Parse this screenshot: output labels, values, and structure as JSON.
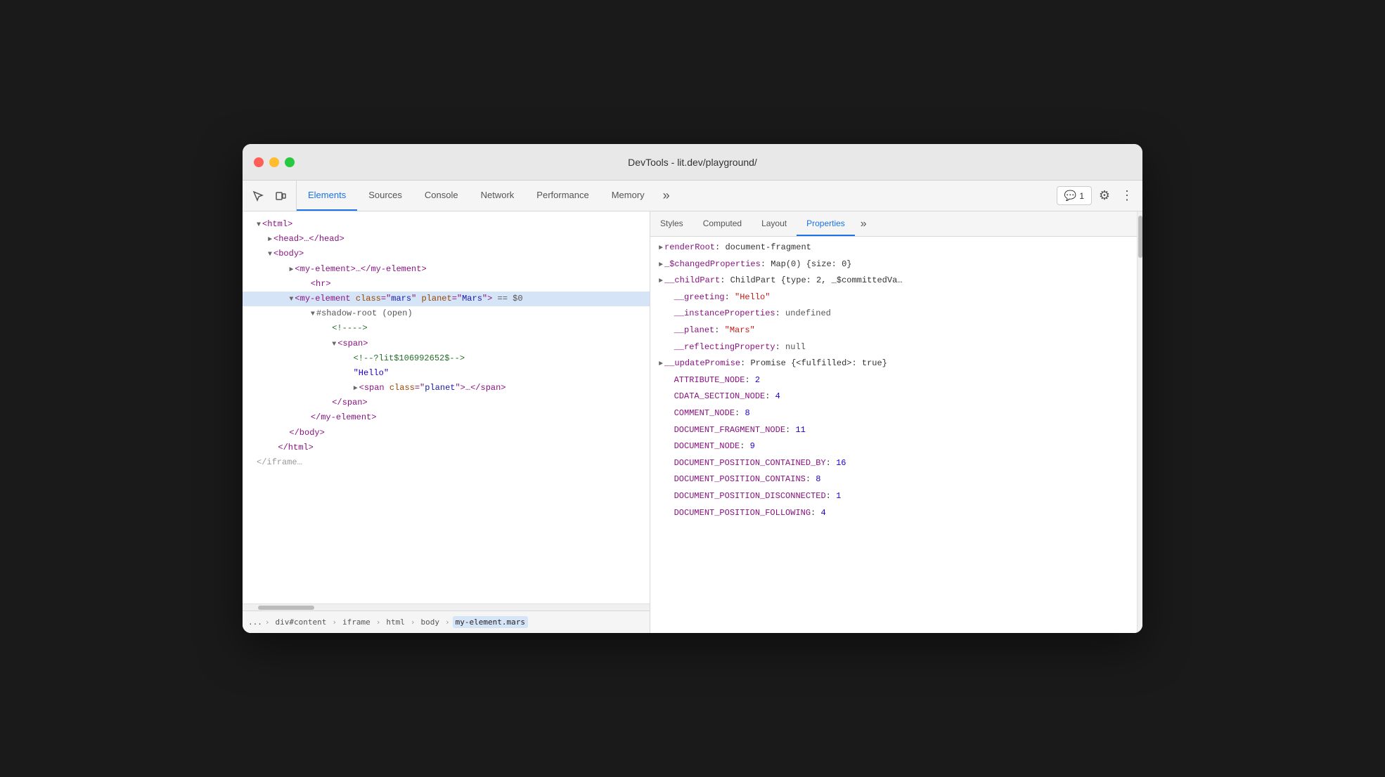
{
  "window": {
    "title": "DevTools - lit.dev/playground/"
  },
  "toolbar": {
    "tabs": [
      {
        "id": "elements",
        "label": "Elements",
        "active": true
      },
      {
        "id": "sources",
        "label": "Sources",
        "active": false
      },
      {
        "id": "console",
        "label": "Console",
        "active": false
      },
      {
        "id": "network",
        "label": "Network",
        "active": false
      },
      {
        "id": "performance",
        "label": "Performance",
        "active": false
      },
      {
        "id": "memory",
        "label": "Memory",
        "active": false
      }
    ],
    "more_tabs": "»",
    "feedback_label": "1",
    "settings_label": "⚙",
    "more_label": "⋮"
  },
  "panel_right": {
    "tabs": [
      {
        "id": "styles",
        "label": "Styles"
      },
      {
        "id": "computed",
        "label": "Computed"
      },
      {
        "id": "layout",
        "label": "Layout"
      },
      {
        "id": "properties",
        "label": "Properties",
        "active": true
      }
    ],
    "more": "»"
  },
  "dom_tree": [
    {
      "indent": 1,
      "content": "▼ <html>",
      "type": "tag"
    },
    {
      "indent": 2,
      "content": "► <head>…</head>",
      "type": "tag"
    },
    {
      "indent": 2,
      "content": "▼ <body>",
      "type": "tag"
    },
    {
      "indent": 3,
      "content": "► <my-element>…</my-element>",
      "type": "tag"
    },
    {
      "indent": 4,
      "content": "<hr>",
      "type": "tag"
    },
    {
      "indent": 3,
      "selected": true,
      "content": "▼ <my-element class=\"mars\" planet=\"Mars\"> == $0",
      "type": "selected"
    },
    {
      "indent": 4,
      "content": "▼ #shadow-root (open)",
      "type": "shadow"
    },
    {
      "indent": 5,
      "content": "<!---->",
      "type": "comment"
    },
    {
      "indent": 5,
      "content": "▼ <span>",
      "type": "tag"
    },
    {
      "indent": 6,
      "content": "<!--?lit$106992652$-->",
      "type": "comment"
    },
    {
      "indent": 6,
      "content": "\"Hello\"",
      "type": "string"
    },
    {
      "indent": 6,
      "content": "► <span class=\"planet\">…</span>",
      "type": "tag"
    },
    {
      "indent": 5,
      "content": "</span>",
      "type": "tag"
    },
    {
      "indent": 4,
      "content": "</my-element>",
      "type": "tag"
    },
    {
      "indent": 3,
      "content": "</body>",
      "type": "tag"
    },
    {
      "indent": 2,
      "content": "</html>",
      "type": "tag"
    },
    {
      "indent": 1,
      "content": "</iframe>",
      "type": "tag-gray"
    }
  ],
  "breadcrumb": {
    "items": [
      {
        "label": "...",
        "dots": true
      },
      {
        "label": "div#content"
      },
      {
        "label": "iframe"
      },
      {
        "label": "html"
      },
      {
        "label": "body"
      },
      {
        "label": "my-element.mars",
        "active": true
      }
    ]
  },
  "properties": [
    {
      "type": "expandable",
      "key": "renderRoot",
      "colon": ": ",
      "value": "document-fragment",
      "value_type": "plain"
    },
    {
      "type": "expandable",
      "key": "_$changedProperties",
      "colon": ": ",
      "value": "Map(0) {size: 0}",
      "value_type": "plain"
    },
    {
      "type": "expandable",
      "key": "__childPart",
      "colon": ": ",
      "value": "ChildPart {type: 2, _$committedVa…",
      "value_type": "plain"
    },
    {
      "type": "plain",
      "key": "__greeting",
      "colon": ": ",
      "value": "\"Hello\"",
      "value_type": "str"
    },
    {
      "type": "plain",
      "key": "__instanceProperties",
      "colon": ": ",
      "value": "undefined",
      "value_type": "null"
    },
    {
      "type": "plain",
      "key": "__planet",
      "colon": ": ",
      "value": "\"Mars\"",
      "value_type": "str"
    },
    {
      "type": "plain",
      "key": "__reflectingProperty",
      "colon": ": ",
      "value": "null",
      "value_type": "null"
    },
    {
      "type": "expandable",
      "key": "__updatePromise",
      "colon": ": ",
      "value": "Promise {<fulfilled>: true}",
      "value_type": "plain"
    },
    {
      "type": "plain",
      "key": "ATTRIBUTE_NODE",
      "colon": ": ",
      "value": "2",
      "value_type": "num"
    },
    {
      "type": "plain",
      "key": "CDATA_SECTION_NODE",
      "colon": ": ",
      "value": "4",
      "value_type": "num"
    },
    {
      "type": "plain",
      "key": "COMMENT_NODE",
      "colon": ": ",
      "value": "8",
      "value_type": "num"
    },
    {
      "type": "plain",
      "key": "DOCUMENT_FRAGMENT_NODE",
      "colon": ": ",
      "value": "11",
      "value_type": "num"
    },
    {
      "type": "plain",
      "key": "DOCUMENT_NODE",
      "colon": ": ",
      "value": "9",
      "value_type": "num"
    },
    {
      "type": "plain",
      "key": "DOCUMENT_POSITION_CONTAINED_BY",
      "colon": ": ",
      "value": "16",
      "value_type": "num"
    },
    {
      "type": "plain",
      "key": "DOCUMENT_POSITION_CONTAINS",
      "colon": ": ",
      "value": "8",
      "value_type": "num"
    },
    {
      "type": "plain",
      "key": "DOCUMENT_POSITION_DISCONNECTED",
      "colon": ": ",
      "value": "1",
      "value_type": "num"
    },
    {
      "type": "plain",
      "key": "DOCUMENT_POSITION_FOLLOWING",
      "colon": ": ",
      "value": "4",
      "value_type": "num"
    }
  ]
}
